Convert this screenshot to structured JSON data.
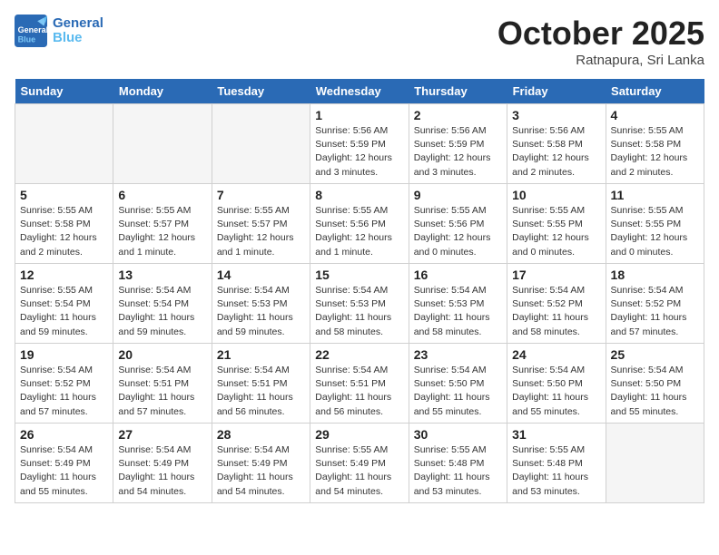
{
  "header": {
    "logo_text_general": "General",
    "logo_text_blue": "Blue",
    "month": "October 2025",
    "location": "Ratnapura, Sri Lanka"
  },
  "days_of_week": [
    "Sunday",
    "Monday",
    "Tuesday",
    "Wednesday",
    "Thursday",
    "Friday",
    "Saturday"
  ],
  "weeks": [
    [
      {
        "day": "",
        "info": ""
      },
      {
        "day": "",
        "info": ""
      },
      {
        "day": "",
        "info": ""
      },
      {
        "day": "1",
        "info": "Sunrise: 5:56 AM\nSunset: 5:59 PM\nDaylight: 12 hours\nand 3 minutes."
      },
      {
        "day": "2",
        "info": "Sunrise: 5:56 AM\nSunset: 5:59 PM\nDaylight: 12 hours\nand 3 minutes."
      },
      {
        "day": "3",
        "info": "Sunrise: 5:56 AM\nSunset: 5:58 PM\nDaylight: 12 hours\nand 2 minutes."
      },
      {
        "day": "4",
        "info": "Sunrise: 5:55 AM\nSunset: 5:58 PM\nDaylight: 12 hours\nand 2 minutes."
      }
    ],
    [
      {
        "day": "5",
        "info": "Sunrise: 5:55 AM\nSunset: 5:58 PM\nDaylight: 12 hours\nand 2 minutes."
      },
      {
        "day": "6",
        "info": "Sunrise: 5:55 AM\nSunset: 5:57 PM\nDaylight: 12 hours\nand 1 minute."
      },
      {
        "day": "7",
        "info": "Sunrise: 5:55 AM\nSunset: 5:57 PM\nDaylight: 12 hours\nand 1 minute."
      },
      {
        "day": "8",
        "info": "Sunrise: 5:55 AM\nSunset: 5:56 PM\nDaylight: 12 hours\nand 1 minute."
      },
      {
        "day": "9",
        "info": "Sunrise: 5:55 AM\nSunset: 5:56 PM\nDaylight: 12 hours\nand 0 minutes."
      },
      {
        "day": "10",
        "info": "Sunrise: 5:55 AM\nSunset: 5:55 PM\nDaylight: 12 hours\nand 0 minutes."
      },
      {
        "day": "11",
        "info": "Sunrise: 5:55 AM\nSunset: 5:55 PM\nDaylight: 12 hours\nand 0 minutes."
      }
    ],
    [
      {
        "day": "12",
        "info": "Sunrise: 5:55 AM\nSunset: 5:54 PM\nDaylight: 11 hours\nand 59 minutes."
      },
      {
        "day": "13",
        "info": "Sunrise: 5:54 AM\nSunset: 5:54 PM\nDaylight: 11 hours\nand 59 minutes."
      },
      {
        "day": "14",
        "info": "Sunrise: 5:54 AM\nSunset: 5:53 PM\nDaylight: 11 hours\nand 59 minutes."
      },
      {
        "day": "15",
        "info": "Sunrise: 5:54 AM\nSunset: 5:53 PM\nDaylight: 11 hours\nand 58 minutes."
      },
      {
        "day": "16",
        "info": "Sunrise: 5:54 AM\nSunset: 5:53 PM\nDaylight: 11 hours\nand 58 minutes."
      },
      {
        "day": "17",
        "info": "Sunrise: 5:54 AM\nSunset: 5:52 PM\nDaylight: 11 hours\nand 58 minutes."
      },
      {
        "day": "18",
        "info": "Sunrise: 5:54 AM\nSunset: 5:52 PM\nDaylight: 11 hours\nand 57 minutes."
      }
    ],
    [
      {
        "day": "19",
        "info": "Sunrise: 5:54 AM\nSunset: 5:52 PM\nDaylight: 11 hours\nand 57 minutes."
      },
      {
        "day": "20",
        "info": "Sunrise: 5:54 AM\nSunset: 5:51 PM\nDaylight: 11 hours\nand 57 minutes."
      },
      {
        "day": "21",
        "info": "Sunrise: 5:54 AM\nSunset: 5:51 PM\nDaylight: 11 hours\nand 56 minutes."
      },
      {
        "day": "22",
        "info": "Sunrise: 5:54 AM\nSunset: 5:51 PM\nDaylight: 11 hours\nand 56 minutes."
      },
      {
        "day": "23",
        "info": "Sunrise: 5:54 AM\nSunset: 5:50 PM\nDaylight: 11 hours\nand 55 minutes."
      },
      {
        "day": "24",
        "info": "Sunrise: 5:54 AM\nSunset: 5:50 PM\nDaylight: 11 hours\nand 55 minutes."
      },
      {
        "day": "25",
        "info": "Sunrise: 5:54 AM\nSunset: 5:50 PM\nDaylight: 11 hours\nand 55 minutes."
      }
    ],
    [
      {
        "day": "26",
        "info": "Sunrise: 5:54 AM\nSunset: 5:49 PM\nDaylight: 11 hours\nand 55 minutes."
      },
      {
        "day": "27",
        "info": "Sunrise: 5:54 AM\nSunset: 5:49 PM\nDaylight: 11 hours\nand 54 minutes."
      },
      {
        "day": "28",
        "info": "Sunrise: 5:54 AM\nSunset: 5:49 PM\nDaylight: 11 hours\nand 54 minutes."
      },
      {
        "day": "29",
        "info": "Sunrise: 5:55 AM\nSunset: 5:49 PM\nDaylight: 11 hours\nand 54 minutes."
      },
      {
        "day": "30",
        "info": "Sunrise: 5:55 AM\nSunset: 5:48 PM\nDaylight: 11 hours\nand 53 minutes."
      },
      {
        "day": "31",
        "info": "Sunrise: 5:55 AM\nSunset: 5:48 PM\nDaylight: 11 hours\nand 53 minutes."
      },
      {
        "day": "",
        "info": ""
      }
    ]
  ]
}
